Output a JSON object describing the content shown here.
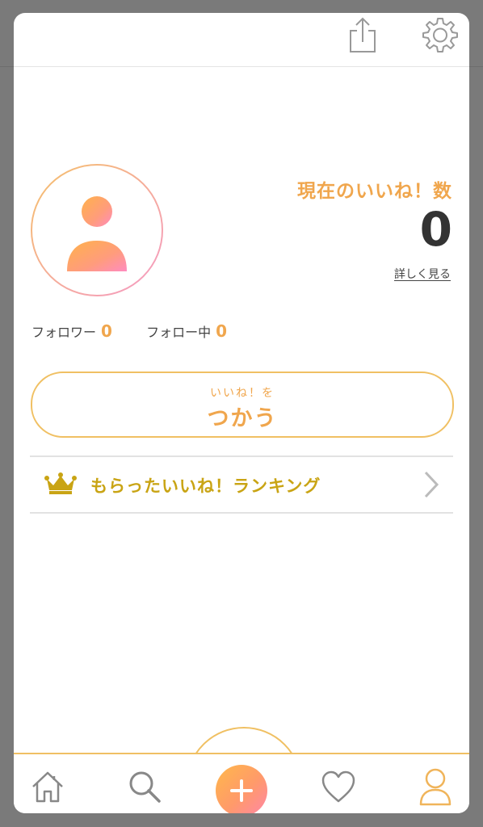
{
  "profile": {
    "likes_label": "現在のいいね！数",
    "likes_count": "0",
    "detail_link": "詳しく見る",
    "followers_label": "フォロワー",
    "followers_count": "0",
    "following_label": "フォロー中",
    "following_count": "0"
  },
  "use_button": {
    "small_label": "いいね！を",
    "big_label": "つかう"
  },
  "ranking": {
    "label": "もらったいいね！ランキング"
  },
  "icons": {
    "share": "share-icon",
    "settings": "gear-icon",
    "avatar": "avatar-icon",
    "crown": "crown-icon",
    "chevron": "chevron-right-icon",
    "home": "home-icon",
    "search": "search-icon",
    "add": "plus-icon",
    "favorites": "heart-icon",
    "profile": "person-icon"
  },
  "colors": {
    "accent_orange": "#f0a64d",
    "ranking_gold": "#c9a414",
    "border_gold": "#f0c063",
    "gradient_start": "#ffb84a",
    "gradient_end": "#ff86a8"
  }
}
